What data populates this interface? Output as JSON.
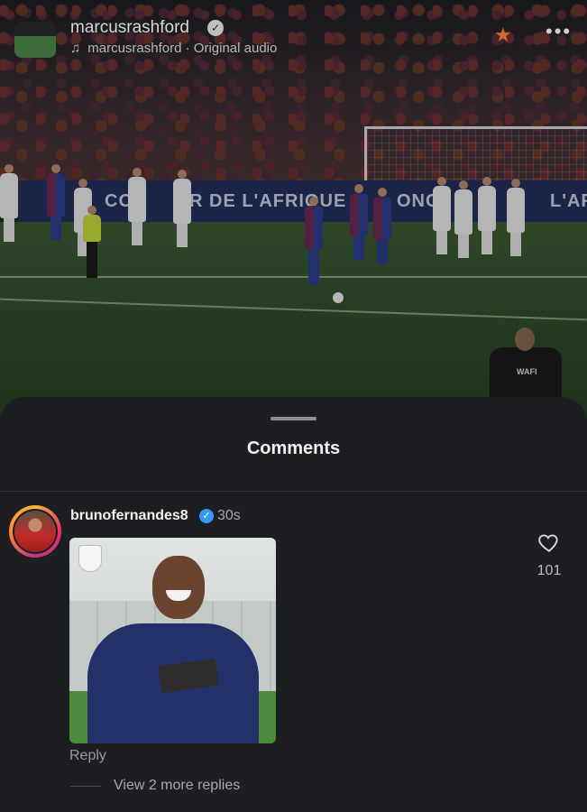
{
  "header": {
    "username": "marcusrashford",
    "audio_owner": "marcusrashford",
    "audio_label": "Original audio",
    "separator": "·"
  },
  "video": {
    "board_left": "R DE L'AFRIQUE",
    "board_cut": "CO",
    "board_mid": "ONG",
    "board_right": "L'AF"
  },
  "comments": {
    "title": "Comments",
    "items": [
      {
        "username": "brunofernandes8",
        "verified": true,
        "time": "30s",
        "attachment": "gif",
        "likes": "101",
        "reply_label": "Reply",
        "view_replies": "View 2 more replies"
      }
    ]
  },
  "colors": {
    "sheet_bg": "#1c1e22",
    "verified_badge": "#3897f0",
    "text_primary": "#f1f1f1",
    "text_secondary": "#a8a8a8"
  },
  "icons": [
    "music-note-icon",
    "verified-icon",
    "star-icon",
    "more-icon",
    "heart-icon"
  ]
}
